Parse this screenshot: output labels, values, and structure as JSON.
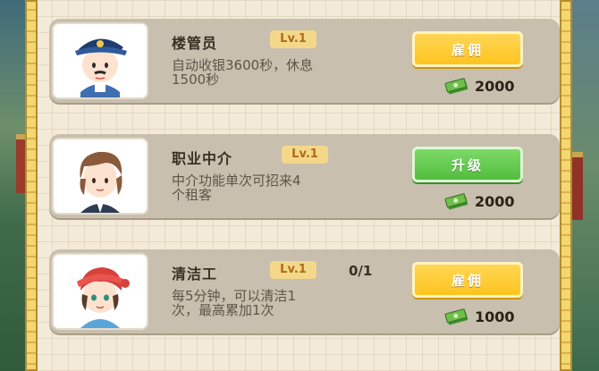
{
  "cards": [
    {
      "name": "楼管员",
      "level": "Lv.1",
      "count": "",
      "desc_line1": "自动收银3600秒，休息",
      "desc_line2": "1500秒",
      "action_label": "雇佣",
      "price": "2000",
      "portrait_icon": "security-guard-avatar-icon"
    },
    {
      "name": "职业中介",
      "level": "Lv.1",
      "count": "",
      "desc_line1": "中介功能单次可招来4",
      "desc_line2": "个租客",
      "action_label": "升级",
      "price": "2000",
      "portrait_icon": "agent-avatar-icon"
    },
    {
      "name": "清洁工",
      "level": "Lv.1",
      "count": "0/1",
      "desc_line1": "每5分钟，可以清洁1",
      "desc_line2": "次，最高累加1次",
      "action_label": "雇佣",
      "price": "1000",
      "portrait_icon": "cleaner-avatar-icon"
    }
  ],
  "colors": {
    "hire_button": "#ffc21a",
    "upgrade_button": "#4fbb3c",
    "card_bg": "#c9bfae",
    "level_badge": "#f3d88a"
  }
}
